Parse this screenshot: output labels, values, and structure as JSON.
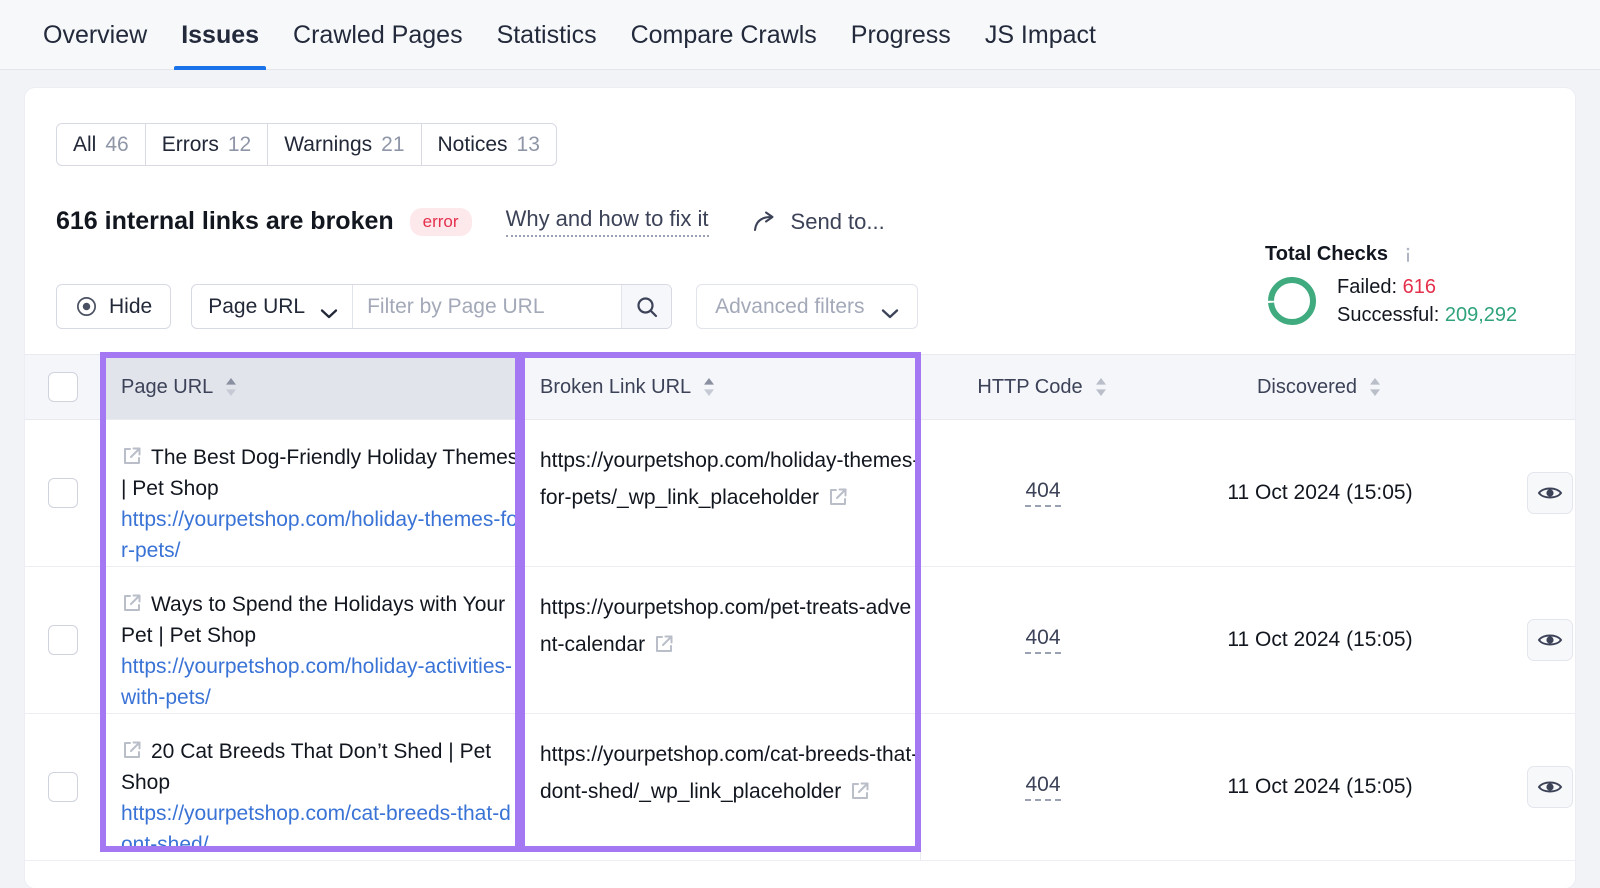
{
  "nav": {
    "items": [
      {
        "label": "Overview",
        "active": false
      },
      {
        "label": "Issues",
        "active": true
      },
      {
        "label": "Crawled Pages",
        "active": false
      },
      {
        "label": "Statistics",
        "active": false
      },
      {
        "label": "Compare Crawls",
        "active": false
      },
      {
        "label": "Progress",
        "active": false
      },
      {
        "label": "JS Impact",
        "active": false
      }
    ]
  },
  "segmented": [
    {
      "label": "All",
      "count": "46"
    },
    {
      "label": "Errors",
      "count": "12"
    },
    {
      "label": "Warnings",
      "count": "21"
    },
    {
      "label": "Notices",
      "count": "13"
    }
  ],
  "issue": {
    "title": "616 internal links are broken",
    "badge": "error",
    "fix_link": "Why and how to fix it",
    "send_to": "Send to..."
  },
  "toolbar": {
    "hide_label": "Hide",
    "select_value": "Page URL",
    "search_placeholder": "Filter by Page URL",
    "search_value": "",
    "advanced_label": "Advanced filters"
  },
  "checks": {
    "title": "Total Checks",
    "failed_label": "Failed:",
    "failed_value": "616",
    "successful_label": "Successful:",
    "successful_value": "209,292",
    "failed_color": "#e5304c",
    "success_color": "#2fa37b"
  },
  "table": {
    "columns": [
      {
        "label": "Page URL"
      },
      {
        "label": "Broken Link URL"
      },
      {
        "label": "HTTP Code"
      },
      {
        "label": "Discovered"
      }
    ],
    "rows": [
      {
        "page_title": "The Best Dog-Friendly Holiday Themes | Pet Shop",
        "page_url": "https://yourpetshop.com/holiday-themes-for-pets/",
        "broken_url": "https://yourpetshop.com/holiday-themes-for-pets/_wp_link_placeholder",
        "http_code": "404",
        "discovered": "11 Oct 2024 (15:05)"
      },
      {
        "page_title": "Ways to Spend the Holidays with Your Pet | Pet Shop",
        "page_url": "https://yourpetshop.com/holiday-activities-with-pets/",
        "broken_url": "https://yourpetshop.com/pet-treats-advent-calendar",
        "http_code": "404",
        "discovered": "11 Oct 2024 (15:05)"
      },
      {
        "page_title": "20 Cat Breeds That Don’t Shed | Pet Shop",
        "page_url": "https://yourpetshop.com/cat-breeds-that-dont-shed/",
        "broken_url": "https://yourpetshop.com/cat-breeds-that-dont-shed/_wp_link_placeholder",
        "http_code": "404",
        "discovered": "11 Oct 2024 (15:05)"
      }
    ]
  },
  "annotations": {
    "highlight_color": "#a478f2",
    "highlighted_columns": [
      "Page URL",
      "Broken Link URL"
    ]
  }
}
